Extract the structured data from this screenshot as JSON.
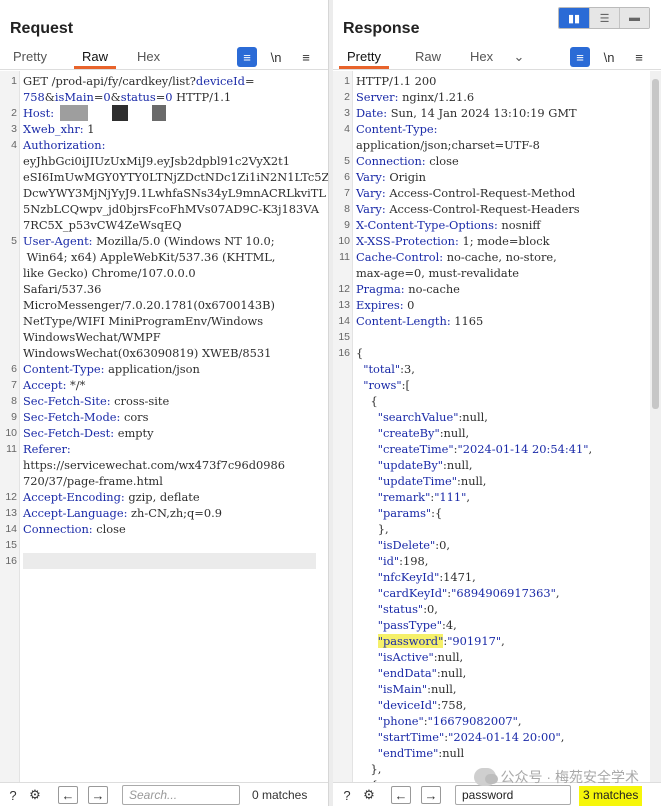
{
  "request": {
    "title": "Request",
    "tabs": [
      "Pretty",
      "Raw",
      "Hex"
    ],
    "active_tab": "Raw",
    "toolbar": {
      "wrap": "≡",
      "newline": "\\n",
      "menu": "≡"
    },
    "lines": [
      [
        {
          "t": "GET /prod-api/fy/cardkey/list?",
          "c": "v"
        },
        {
          "t": "deviceId",
          "c": "k"
        },
        {
          "t": "=",
          "c": "v"
        }
      ],
      [
        {
          "t": "758",
          "c": "k"
        },
        {
          "t": "&",
          "c": "v"
        },
        {
          "t": "isMain",
          "c": "k"
        },
        {
          "t": "=",
          "c": "v"
        },
        {
          "t": "0",
          "c": "k"
        },
        {
          "t": "&",
          "c": "v"
        },
        {
          "t": "status",
          "c": "k"
        },
        {
          "t": "=",
          "c": "v"
        },
        {
          "t": "0",
          "c": "k"
        },
        {
          "t": " HTTP/1.1",
          "c": "v"
        }
      ],
      [
        {
          "t": "Host:",
          "c": "k"
        }
      ],
      [
        {
          "t": "Xweb_xhr:",
          "c": "k"
        },
        {
          "t": " 1",
          "c": "v"
        }
      ],
      [
        {
          "t": "Authorization:",
          "c": "k"
        }
      ],
      [
        {
          "t": "eyJhbGci0iJIUzUxMiJ9.eyJsb2dpbl91c2VyX2t1",
          "c": "v"
        }
      ],
      [
        {
          "t": "eSI6ImUwMGY0YTY0LTNjZDctNDc1Zi1iN2N1LTc5Z",
          "c": "v"
        }
      ],
      [
        {
          "t": "DcwYWY3MjNjYyJ9.1LwhfaSNs34yL9mnACRLkviTL",
          "c": "v"
        }
      ],
      [
        {
          "t": "5NzbLCQwpv_jd0bjrsFcoFhMVs07AD9C-K3j183VA",
          "c": "v"
        }
      ],
      [
        {
          "t": "7RC5X_p53vCW4ZeWsqEQ",
          "c": "v"
        }
      ],
      [
        {
          "t": "User-Agent:",
          "c": "k"
        },
        {
          "t": " Mozilla/5.0 (Windows NT 10.0;",
          "c": "v"
        }
      ],
      [
        {
          "t": " Win64; x64) AppleWebKit/537.36 (KHTML,",
          "c": "v"
        }
      ],
      [
        {
          "t": "like Gecko) Chrome/107.0.0.0",
          "c": "v"
        }
      ],
      [
        {
          "t": "Safari/537.36",
          "c": "v"
        }
      ],
      [
        {
          "t": "MicroMessenger/7.0.20.1781(0x6700143B)",
          "c": "v"
        }
      ],
      [
        {
          "t": "NetType/WIFI MiniProgramEnv/Windows",
          "c": "v"
        }
      ],
      [
        {
          "t": "WindowsWechat/WMPF",
          "c": "v"
        }
      ],
      [
        {
          "t": "WindowsWechat(0x63090819) XWEB/8531",
          "c": "v"
        }
      ],
      [
        {
          "t": "Content-Type:",
          "c": "k"
        },
        {
          "t": " application/json",
          "c": "v"
        }
      ],
      [
        {
          "t": "Accept:",
          "c": "k"
        },
        {
          "t": " */*",
          "c": "v"
        }
      ],
      [
        {
          "t": "Sec-Fetch-Site:",
          "c": "k"
        },
        {
          "t": " cross-site",
          "c": "v"
        }
      ],
      [
        {
          "t": "Sec-Fetch-Mode:",
          "c": "k"
        },
        {
          "t": " cors",
          "c": "v"
        }
      ],
      [
        {
          "t": "Sec-Fetch-Dest:",
          "c": "k"
        },
        {
          "t": " empty",
          "c": "v"
        }
      ],
      [
        {
          "t": "Referer:",
          "c": "k"
        }
      ],
      [
        {
          "t": "https://servicewechat.com/wx473f7c96d0986",
          "c": "v"
        }
      ],
      [
        {
          "t": "720/37/page-frame.html",
          "c": "v"
        }
      ],
      [
        {
          "t": "Accept-Encoding:",
          "c": "k"
        },
        {
          "t": " gzip, deflate",
          "c": "v"
        }
      ],
      [
        {
          "t": "Accept-Language:",
          "c": "k"
        },
        {
          "t": " zh-CN,zh;q=0.9",
          "c": "v"
        }
      ],
      [
        {
          "t": "Connection:",
          "c": "k"
        },
        {
          "t": " close",
          "c": "v"
        }
      ],
      [],
      []
    ],
    "line_numbers": [
      "1",
      "",
      "2",
      "3",
      "4",
      "",
      "",
      "",
      "",
      "",
      "5",
      "",
      "",
      "",
      "",
      "",
      "",
      "",
      "6",
      "7",
      "8",
      "9",
      "10",
      "11",
      "",
      "",
      "12",
      "13",
      "14",
      "15",
      "16"
    ],
    "footer": {
      "search_placeholder": "Search...",
      "matches": "0 matches"
    }
  },
  "response": {
    "title": "Response",
    "tabs": [
      "Pretty",
      "Raw",
      "Hex"
    ],
    "active_tab": "Pretty",
    "toolbar": {
      "wrap": "≡",
      "newline": "\\n",
      "menu": "≡"
    },
    "lines": [
      [
        {
          "t": "HTTP/1.1 200",
          "c": "v"
        }
      ],
      [
        {
          "t": "Server:",
          "c": "k"
        },
        {
          "t": " nginx/1.21.6",
          "c": "v"
        }
      ],
      [
        {
          "t": "Date:",
          "c": "k"
        },
        {
          "t": " Sun, 14 Jan 2024 13:10:19 GMT",
          "c": "v"
        }
      ],
      [
        {
          "t": "Content-Type:",
          "c": "k"
        }
      ],
      [
        {
          "t": "application/json;charset=UTF-8",
          "c": "v"
        }
      ],
      [
        {
          "t": "Connection:",
          "c": "k"
        },
        {
          "t": " close",
          "c": "v"
        }
      ],
      [
        {
          "t": "Vary:",
          "c": "k"
        },
        {
          "t": " Origin",
          "c": "v"
        }
      ],
      [
        {
          "t": "Vary:",
          "c": "k"
        },
        {
          "t": " Access-Control-Request-Method",
          "c": "v"
        }
      ],
      [
        {
          "t": "Vary:",
          "c": "k"
        },
        {
          "t": " Access-Control-Request-Headers",
          "c": "v"
        }
      ],
      [
        {
          "t": "X-Content-Type-Options:",
          "c": "k"
        },
        {
          "t": " nosniff",
          "c": "v"
        }
      ],
      [
        {
          "t": "X-XSS-Protection:",
          "c": "k"
        },
        {
          "t": " 1; mode=block",
          "c": "v"
        }
      ],
      [
        {
          "t": "Cache-Control:",
          "c": "k"
        },
        {
          "t": " no-cache, no-store,",
          "c": "v"
        }
      ],
      [
        {
          "t": "max-age=0, must-revalidate",
          "c": "v"
        }
      ],
      [
        {
          "t": "Pragma:",
          "c": "k"
        },
        {
          "t": " no-cache",
          "c": "v"
        }
      ],
      [
        {
          "t": "Expires:",
          "c": "k"
        },
        {
          "t": " 0",
          "c": "v"
        }
      ],
      [
        {
          "t": "Content-Length:",
          "c": "k"
        },
        {
          "t": " 1165",
          "c": "v"
        }
      ],
      [],
      [
        {
          "t": "{",
          "c": "v"
        }
      ],
      [
        {
          "t": "  \"total\"",
          "c": "s"
        },
        {
          "t": ":3,",
          "c": "v"
        }
      ],
      [
        {
          "t": "  \"rows\"",
          "c": "s"
        },
        {
          "t": ":[",
          "c": "v"
        }
      ],
      [
        {
          "t": "    {",
          "c": "v"
        }
      ],
      [
        {
          "t": "      \"searchValue\"",
          "c": "s"
        },
        {
          "t": ":null,",
          "c": "v"
        }
      ],
      [
        {
          "t": "      \"createBy\"",
          "c": "s"
        },
        {
          "t": ":null,",
          "c": "v"
        }
      ],
      [
        {
          "t": "      \"createTime\"",
          "c": "s"
        },
        {
          "t": ":",
          "c": "v"
        },
        {
          "t": "\"2024-01-14 20:54:41\"",
          "c": "s"
        },
        {
          "t": ",",
          "c": "v"
        }
      ],
      [
        {
          "t": "      \"updateBy\"",
          "c": "s"
        },
        {
          "t": ":null,",
          "c": "v"
        }
      ],
      [
        {
          "t": "      \"updateTime\"",
          "c": "s"
        },
        {
          "t": ":null,",
          "c": "v"
        }
      ],
      [
        {
          "t": "      \"remark\"",
          "c": "s"
        },
        {
          "t": ":",
          "c": "v"
        },
        {
          "t": "\"111\"",
          "c": "s"
        },
        {
          "t": ",",
          "c": "v"
        }
      ],
      [
        {
          "t": "      \"params\"",
          "c": "s"
        },
        {
          "t": ":{",
          "c": "v"
        }
      ],
      [
        {
          "t": "      },",
          "c": "v"
        }
      ],
      [
        {
          "t": "      \"isDelete\"",
          "c": "s"
        },
        {
          "t": ":0,",
          "c": "v"
        }
      ],
      [
        {
          "t": "      \"id\"",
          "c": "s"
        },
        {
          "t": ":198,",
          "c": "v"
        }
      ],
      [
        {
          "t": "      \"nfcKeyId\"",
          "c": "s"
        },
        {
          "t": ":1471,",
          "c": "v"
        }
      ],
      [
        {
          "t": "      \"cardKeyId\"",
          "c": "s"
        },
        {
          "t": ":",
          "c": "v"
        },
        {
          "t": "\"6894906917363\"",
          "c": "s"
        },
        {
          "t": ",",
          "c": "v"
        }
      ],
      [
        {
          "t": "      \"status\"",
          "c": "s"
        },
        {
          "t": ":0,",
          "c": "v"
        }
      ],
      [
        {
          "t": "      \"passType\"",
          "c": "s"
        },
        {
          "t": ":4,",
          "c": "v"
        }
      ],
      [
        {
          "t": "      ",
          "c": "v"
        },
        {
          "t": "\"password\"",
          "c": "s",
          "hl": true
        },
        {
          "t": ":",
          "c": "v"
        },
        {
          "t": "\"901917\"",
          "c": "s"
        },
        {
          "t": ",",
          "c": "v"
        }
      ],
      [
        {
          "t": "      \"isActive\"",
          "c": "s"
        },
        {
          "t": ":null,",
          "c": "v"
        }
      ],
      [
        {
          "t": "      \"endData\"",
          "c": "s"
        },
        {
          "t": ":null,",
          "c": "v"
        }
      ],
      [
        {
          "t": "      \"isMain\"",
          "c": "s"
        },
        {
          "t": ":null,",
          "c": "v"
        }
      ],
      [
        {
          "t": "      \"deviceId\"",
          "c": "s"
        },
        {
          "t": ":758,",
          "c": "v"
        }
      ],
      [
        {
          "t": "      \"phone\"",
          "c": "s"
        },
        {
          "t": ":",
          "c": "v"
        },
        {
          "t": "\"16679082007\"",
          "c": "s"
        },
        {
          "t": ",",
          "c": "v"
        }
      ],
      [
        {
          "t": "      \"startTime\"",
          "c": "s"
        },
        {
          "t": ":",
          "c": "v"
        },
        {
          "t": "\"2024-01-14 20:00\"",
          "c": "s"
        },
        {
          "t": ",",
          "c": "v"
        }
      ],
      [
        {
          "t": "      \"endTime\"",
          "c": "s"
        },
        {
          "t": ":null",
          "c": "v"
        }
      ],
      [
        {
          "t": "    },",
          "c": "v"
        }
      ],
      [
        {
          "t": "    {",
          "c": "v"
        }
      ]
    ],
    "line_numbers": [
      "1",
      "2",
      "3",
      "4",
      "",
      "5",
      "6",
      "7",
      "8",
      "9",
      "10",
      "11",
      "",
      "12",
      "13",
      "14",
      "15",
      "16",
      "",
      "",
      "",
      "",
      "",
      "",
      "",
      "",
      "",
      "",
      "",
      "",
      "",
      "",
      "",
      "",
      "",
      "",
      "",
      "",
      "",
      "",
      "",
      "",
      "",
      "",
      ""
    ],
    "footer": {
      "search_value": "password",
      "matches": "3 matches"
    }
  },
  "watermark": "公众号 · 梅苑安全学术",
  "colors": {
    "accent": "#e8632b",
    "key": "#1a2aa8",
    "highlight": "#f5f06a",
    "match_bg": "#f6f60a",
    "toolbar_blue": "#2b6bd6"
  }
}
